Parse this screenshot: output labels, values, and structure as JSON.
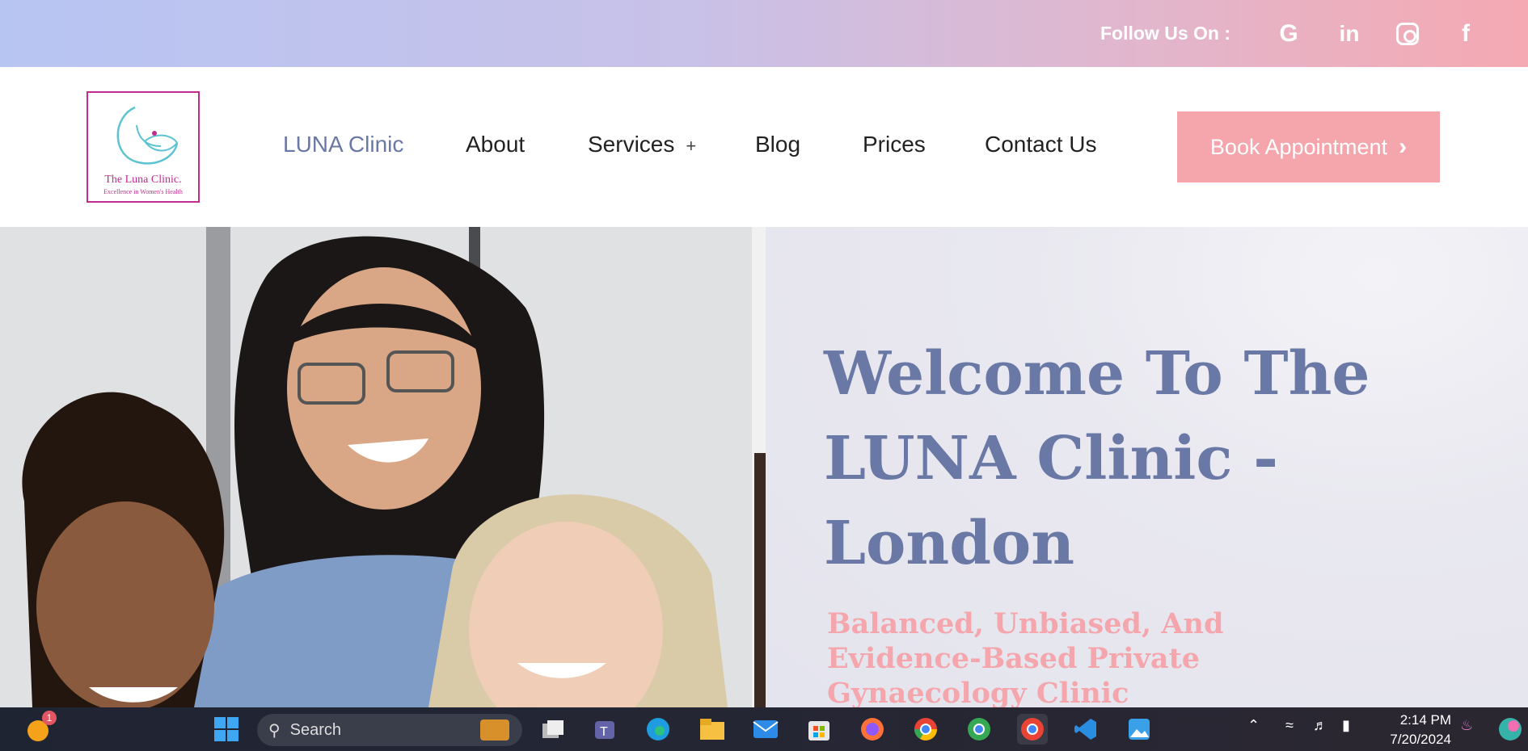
{
  "topbar": {
    "follow_label": "Follow Us On :",
    "social": [
      "google-icon",
      "linkedin-icon",
      "instagram-icon",
      "facebook-icon"
    ]
  },
  "logo": {
    "name": "The Luna Clinic.",
    "tagline": "Excellence in Women's Health"
  },
  "nav": {
    "items": [
      {
        "label": "LUNA Clinic",
        "active": true
      },
      {
        "label": "About"
      },
      {
        "label": "Services",
        "has_submenu": true,
        "submenu_glyph": "+"
      },
      {
        "label": "Blog"
      },
      {
        "label": "Prices"
      },
      {
        "label": "Contact Us"
      }
    ],
    "cta_label": "Book Appointment"
  },
  "hero": {
    "title": "Welcome To The LUNA Clinic - London",
    "subtitle": "Balanced, Unbiased, And Evidence-Based Private Gynaecology Clinic"
  },
  "taskbar": {
    "search_placeholder": "Search",
    "notification_count": "1",
    "time": "2:14 PM",
    "date": "7/20/2024"
  },
  "colors": {
    "brand_blue": "#6a78a5",
    "brand_pink": "#f5a6ad",
    "logo_magenta": "#c22b8f"
  }
}
